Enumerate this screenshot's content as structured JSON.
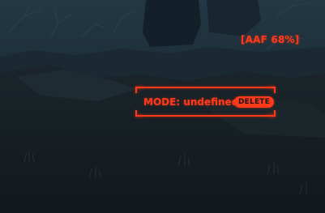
{
  "hud": {
    "aaf_status": "[AAF 68%]",
    "mode_prefix": "MODE:",
    "mode_value": "undefined",
    "delete_label": "DELETE",
    "accent_color": "#ff3a1a"
  }
}
